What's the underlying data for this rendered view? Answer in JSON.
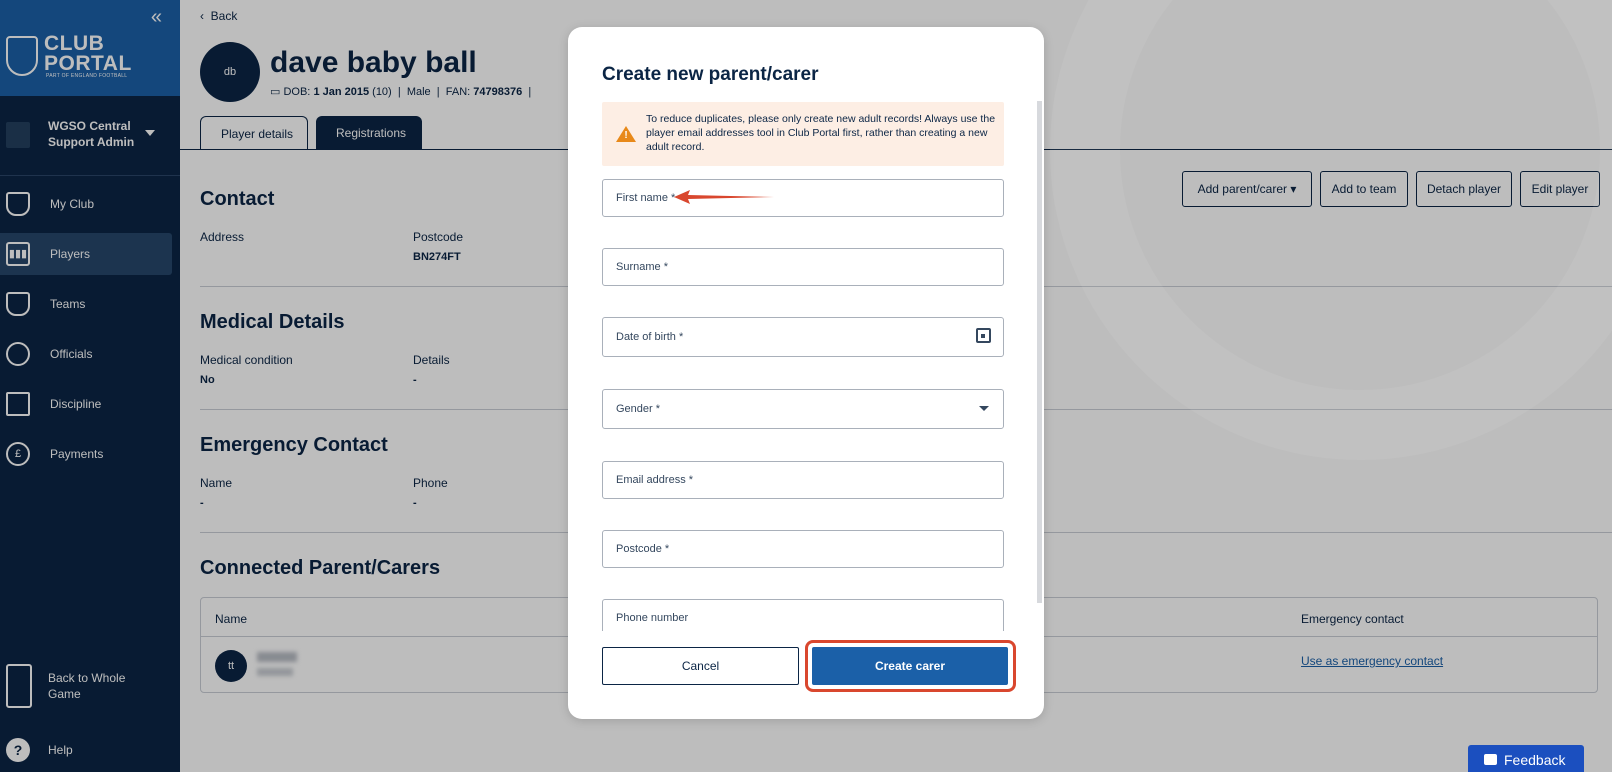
{
  "sidebar": {
    "collapse_icon": "chevrons-left-icon",
    "logo": {
      "line1": "CLUB",
      "line2": "PORTAL",
      "sub": "PART OF ENGLAND FOOTBALL"
    },
    "club": {
      "name_line1": "WGSO Central",
      "name_line2": "Support Admin"
    },
    "items": [
      {
        "label": "My Club",
        "icon": "shield-icon"
      },
      {
        "label": "Players",
        "icon": "players-icon",
        "active": true
      },
      {
        "label": "Teams",
        "icon": "shirt-icon"
      },
      {
        "label": "Officials",
        "icon": "officials-icon"
      },
      {
        "label": "Discipline",
        "icon": "cards-icon"
      },
      {
        "label": "Payments",
        "icon": "pound-icon"
      }
    ],
    "back_to_whole_game": {
      "line1": "Back to Whole",
      "line2": "Game"
    },
    "help": "Help"
  },
  "page": {
    "back": "Back",
    "avatar_initials": "db",
    "player_name": "dave baby ball",
    "meta": {
      "dob_label": "DOB:",
      "dob_value": "1 Jan 2015",
      "age": "(10)",
      "gender": "Male",
      "fan_label": "FAN:",
      "fan_value": "74798376"
    },
    "tabs": [
      "Player details",
      "Registrations"
    ],
    "actions": {
      "add_parent": "Add parent/carer",
      "add_team": "Add to team",
      "detach": "Detach player",
      "edit": "Edit player"
    },
    "contact": {
      "title": "Contact",
      "address_label": "Address",
      "postcode_label": "Postcode",
      "postcode_value": "BN274FT"
    },
    "medical": {
      "title": "Medical Details",
      "condition_label": "Medical condition",
      "condition_value": "No",
      "details_label": "Details",
      "details_value": "-"
    },
    "emergency": {
      "title": "Emergency Contact",
      "name_label": "Name",
      "name_value": "-",
      "phone_label": "Phone",
      "phone_value": "-"
    },
    "connected": {
      "title": "Connected Parent/Carers",
      "columns": {
        "name": "Name",
        "emergency": "Emergency contact"
      },
      "row": {
        "initials": "tt",
        "link": "Use as emergency contact"
      }
    },
    "feedback": "Feedback"
  },
  "modal": {
    "title": "Create new parent/carer",
    "warning": "To reduce duplicates, please only create new adult records! Always use the player email addresses tool in Club Portal first, rather than creating a new adult record.",
    "fields": {
      "first_name": "First name *",
      "surname": "Surname *",
      "dob": "Date of birth *",
      "gender": "Gender *",
      "email": "Email address *",
      "postcode": "Postcode *",
      "phone": "Phone number"
    },
    "cancel": "Cancel",
    "create": "Create carer"
  },
  "colors": {
    "navy": "#0b2545",
    "brand_blue": "#1b60a8",
    "highlight": "#d9472e",
    "warning_bg": "#fdeee4"
  }
}
